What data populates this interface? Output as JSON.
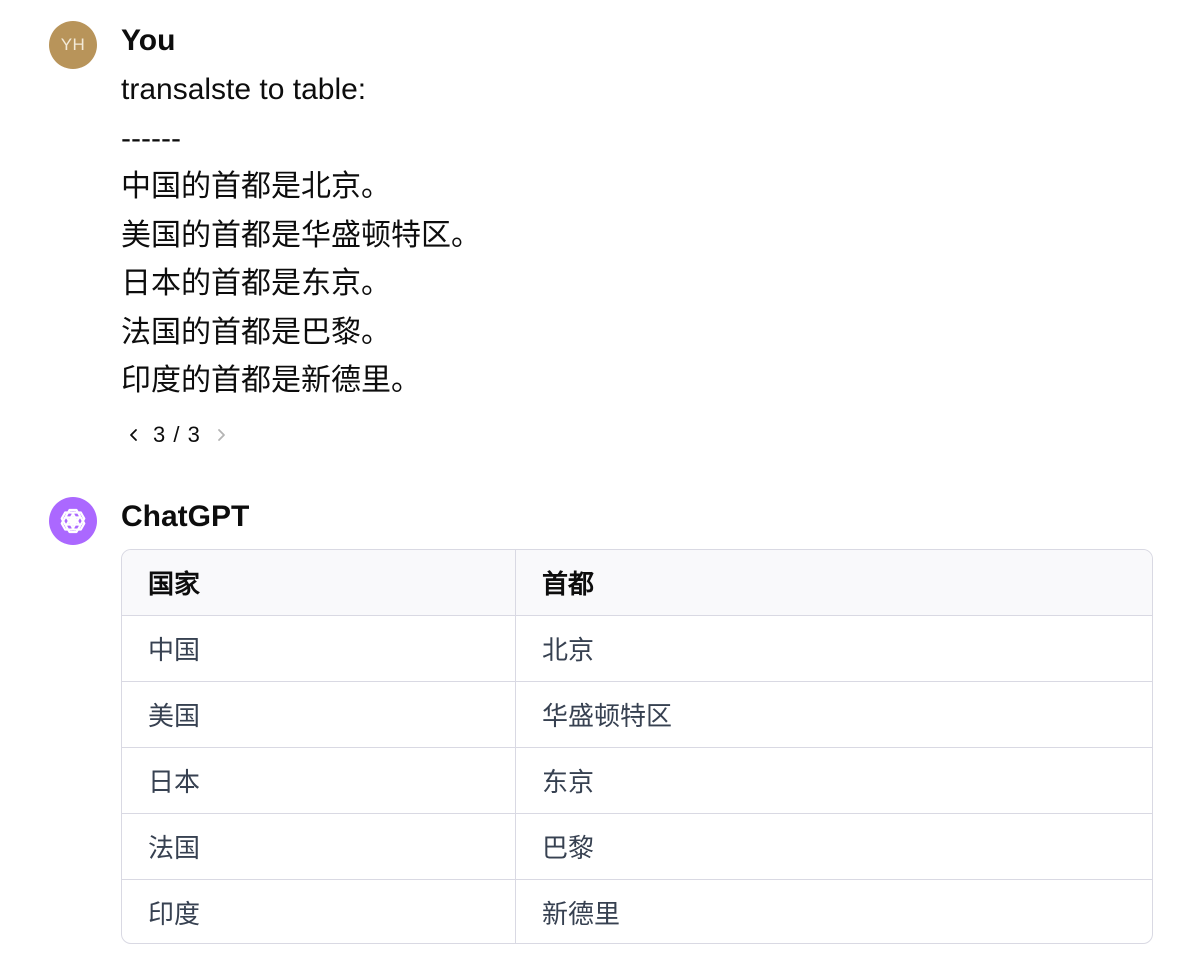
{
  "user": {
    "avatar_initials": "YH",
    "name": "You",
    "message_lines": [
      "transalste to table:",
      "------",
      "中国的首都是北京。",
      "美国的首都是华盛顿特区。",
      "日本的首都是东京。",
      "法国的首都是巴黎。",
      "印度的首都是新德里。"
    ],
    "pager": "3 / 3",
    "avatar_color": "#b8945a"
  },
  "assistant": {
    "name": "ChatGPT",
    "avatar_icon": "openai-logo-icon",
    "avatar_color": "#ab68ff",
    "table": {
      "headers": [
        "国家",
        "首都"
      ],
      "rows": [
        [
          "中国",
          "北京"
        ],
        [
          "美国",
          "华盛顿特区"
        ],
        [
          "日本",
          "东京"
        ],
        [
          "法国",
          "巴黎"
        ],
        [
          "印度",
          "新德里"
        ]
      ]
    }
  }
}
